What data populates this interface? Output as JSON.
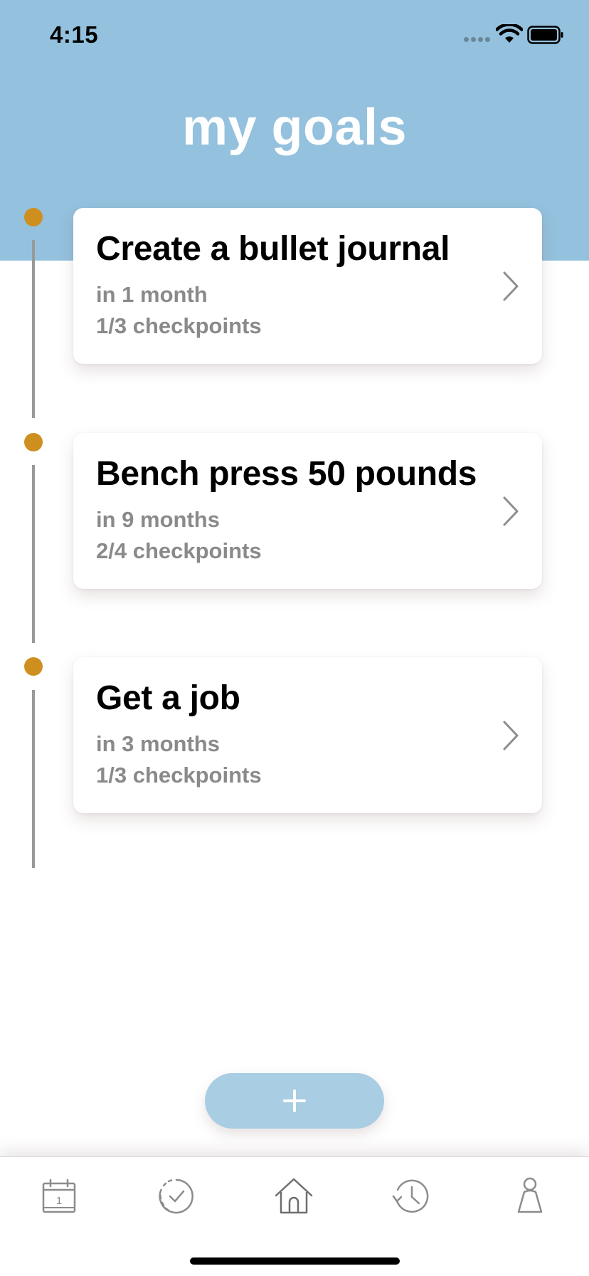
{
  "status_bar": {
    "time": "4:15"
  },
  "header": {
    "title": "my goals"
  },
  "goals": [
    {
      "title": "Create a bullet journal",
      "timeframe": "in 1 month",
      "checkpoints": "1/3 checkpoints"
    },
    {
      "title": "Bench press 50 pounds",
      "timeframe": "in 9 months",
      "checkpoints": "2/4 checkpoints"
    },
    {
      "title": "Get a job",
      "timeframe": "in 3 months",
      "checkpoints": "1/3 checkpoints"
    }
  ],
  "add_button": {
    "label": "+"
  },
  "tab_bar": {
    "items": [
      {
        "icon": "calendar-icon",
        "calendar_day": "1"
      },
      {
        "icon": "checkmark-circle-icon"
      },
      {
        "icon": "home-icon"
      },
      {
        "icon": "history-clock-icon"
      },
      {
        "icon": "profile-icon"
      }
    ]
  },
  "colors": {
    "header": "#93c1de",
    "timeline_dot": "#cf8f1f",
    "add_button": "#a9cde2",
    "secondary_text": "#8a8a8a"
  }
}
